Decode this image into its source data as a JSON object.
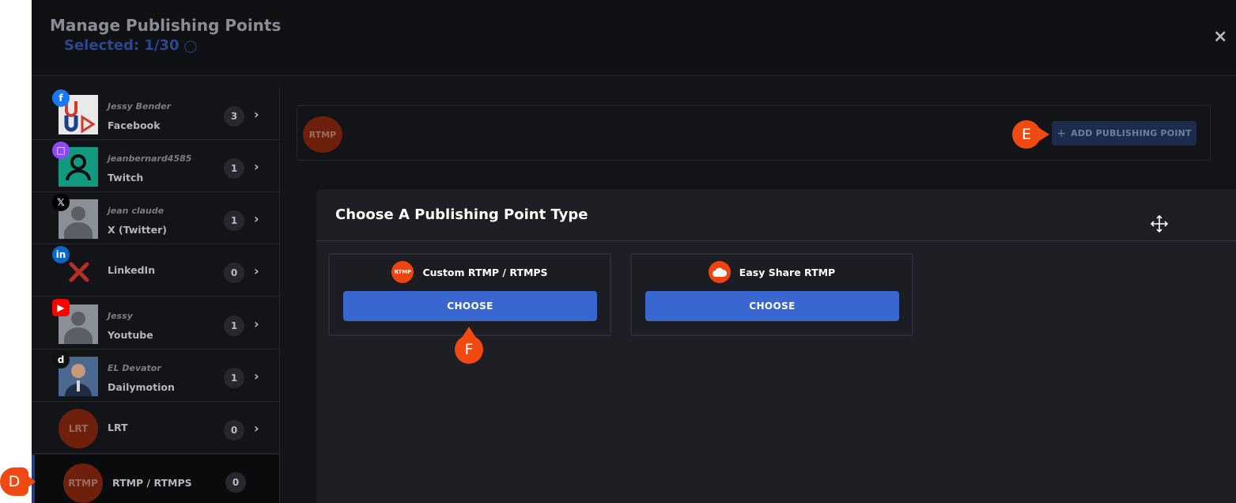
{
  "modal": {
    "title": "Manage Publishing Points",
    "selected": "Selected: 1/30",
    "close_label": "×"
  },
  "sidebar": {
    "items": [
      {
        "user": "Jessy Bender",
        "platform": "Facebook",
        "count": "3",
        "badge_icon": "facebook-icon",
        "badge_color": "#1877f2"
      },
      {
        "user": "jeanbernard4585",
        "platform": "Twitch",
        "count": "1",
        "badge_icon": "twitch-icon",
        "badge_color": "#9146ff"
      },
      {
        "user": "jean claude",
        "platform": "X (Twitter)",
        "count": "1",
        "badge_icon": "x-icon",
        "badge_color": "#000000"
      },
      {
        "user": "",
        "platform": "LinkedIn",
        "count": "0",
        "badge_icon": "linkedin-icon",
        "badge_color": "#0a66c2"
      },
      {
        "user": "Jessy",
        "platform": "Youtube",
        "count": "1",
        "badge_icon": "youtube-icon",
        "badge_color": "#ff0000"
      },
      {
        "user": "EL Devator",
        "platform": "Dailymotion",
        "count": "1",
        "badge_icon": "dailymotion-icon",
        "badge_color": "#111111"
      },
      {
        "user": "",
        "platform": "LRT",
        "count": "0",
        "avatar_text": "LRT"
      },
      {
        "user": "",
        "platform": "RTMP / RTMPS",
        "count": "0",
        "avatar_text": "RTMP"
      }
    ]
  },
  "toolbar": {
    "avatar_text": "RTMP",
    "add_button": "ADD PUBLISHING POINT"
  },
  "dialog": {
    "title": "Choose A Publishing Point Type",
    "cards": [
      {
        "logo_text": "RTMP",
        "label": "Custom RTMP / RTMPS",
        "button": "CHOOSE"
      },
      {
        "logo_icon": "cloud-icon",
        "label": "Easy Share RTMP",
        "button": "CHOOSE"
      }
    ]
  },
  "callouts": {
    "d": "D",
    "e": "E",
    "f": "F"
  },
  "colors": {
    "accent": "#3a67cf",
    "callout": "#f04a12",
    "background": "#131418"
  }
}
